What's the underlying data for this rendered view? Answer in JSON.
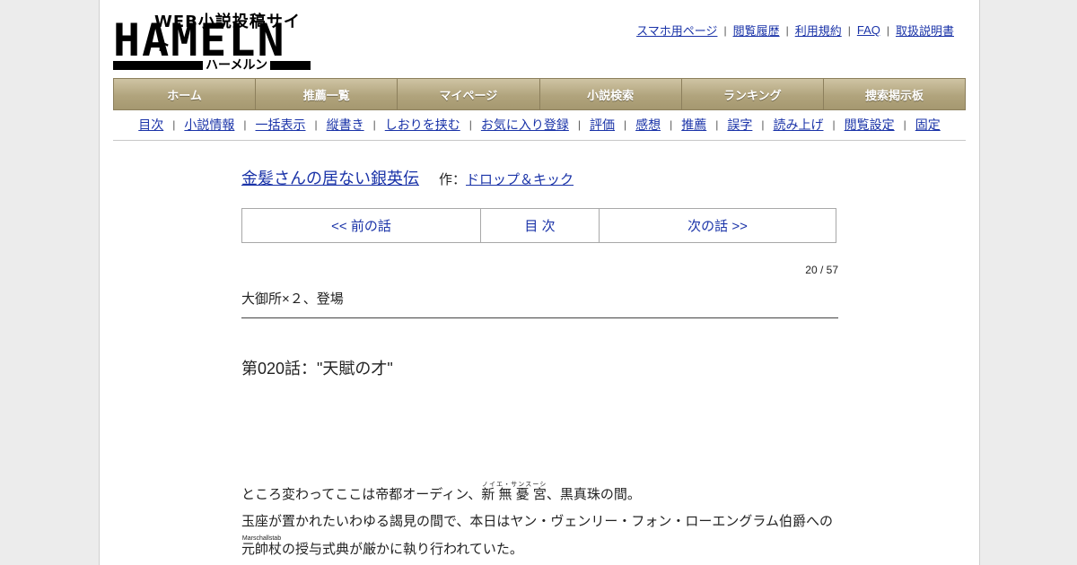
{
  "logo": {
    "main": "HAMELN",
    "tagline": "WEB小説投稿サイト",
    "kana": "ハーメルン"
  },
  "top_links": [
    "スマホ用ページ",
    "閲覧履歴",
    "利用規約",
    "FAQ",
    "取扱説明書"
  ],
  "main_nav": [
    "ホーム",
    "推薦一覧",
    "マイページ",
    "小説検索",
    "ランキング",
    "捜索掲示板"
  ],
  "sub_nav": [
    "目次",
    "小説情報",
    "一括表示",
    "縦書き",
    "しおりを挟む",
    "お気に入り登録",
    "評価",
    "感想",
    "推薦",
    "誤字",
    "読み上げ",
    "閲覧設定",
    "固定"
  ],
  "novel": {
    "title": "金髪さんの居ない銀英伝",
    "author_prefix": "作：",
    "author": "ドロップ＆キック"
  },
  "pager": {
    "prev": "<< 前の話",
    "toc": "目 次",
    "next": "次の話 >>"
  },
  "episode": {
    "count": "20 / 57",
    "chapter_group": "大御所×２、登場",
    "title": "第020話：\"天賦の才\""
  },
  "body": {
    "p1_a": "ところ変わってここは帝都オーディン、",
    "p1_ruby_base": "新 無 憂 宮",
    "p1_ruby": "ノイエ・サンスーシ",
    "p1_b": "、黒真珠の間。",
    "p2": "玉座が置かれたいわゆる謁見の間で、本日はヤン・ヴェンリー・フォン・ローエングラム伯爵への",
    "p3_ruby_base": "元帥杖",
    "p3_ruby": "Marschallstab",
    "p3_b": "の授与式典が厳かに執り行われていた。"
  }
}
